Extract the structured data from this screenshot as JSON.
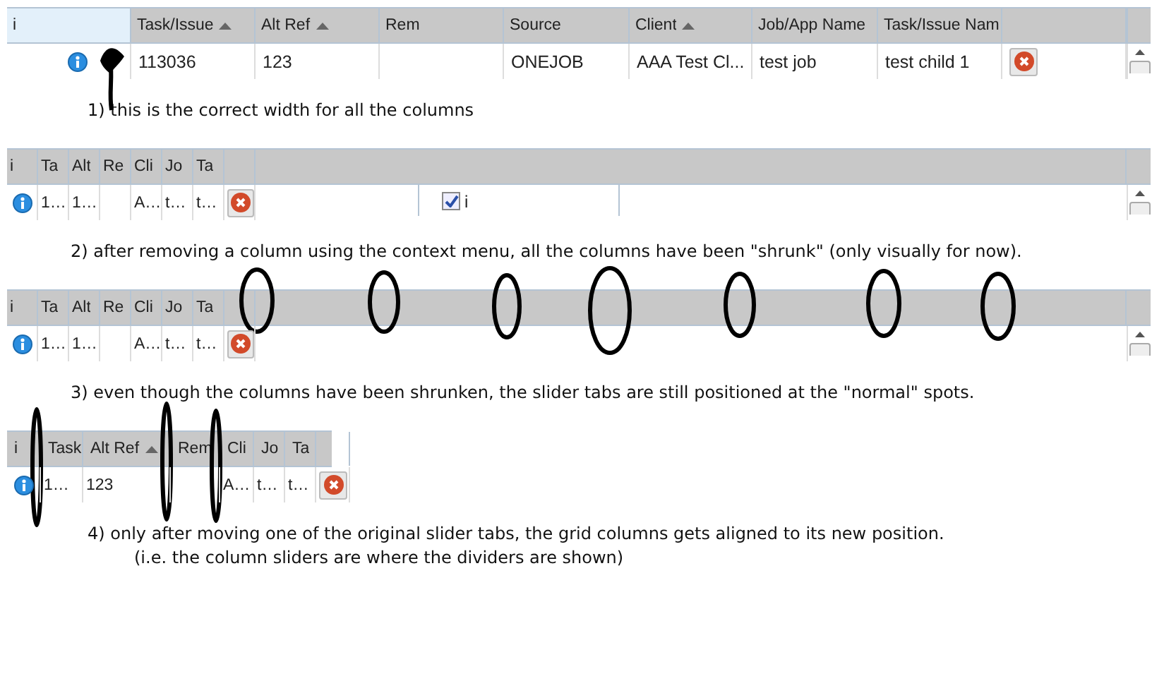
{
  "panels": [
    {
      "kind": "wide",
      "columns": [
        {
          "kind": "info",
          "label": "i",
          "sorted": false,
          "highlighted": true
        },
        {
          "kind": "text",
          "label": "Task/Issue",
          "sorted": true,
          "highlighted": false,
          "value": "113036"
        },
        {
          "kind": "text",
          "label": "Alt Ref",
          "sorted": true,
          "highlighted": false,
          "value": "123"
        },
        {
          "kind": "text",
          "label": "Rem",
          "sorted": false,
          "highlighted": false
        },
        {
          "kind": "text",
          "label": "Source",
          "sorted": false,
          "highlighted": false,
          "value": "ONEJOB"
        },
        {
          "kind": "text",
          "label": "Client",
          "sorted": true,
          "highlighted": false,
          "value": "AAA Test Cl..."
        },
        {
          "kind": "text",
          "label": "Job/App Name",
          "sorted": false,
          "highlighted": false,
          "value": "test job"
        },
        {
          "kind": "text",
          "label": "Task/Issue Nam",
          "sorted": false,
          "highlighted": false,
          "value": "test child 1"
        },
        {
          "kind": "action",
          "sorted": false,
          "highlighted": false
        }
      ],
      "caption": [
        "1) this is the correct width for all the columns"
      ]
    },
    {
      "kind": "shrunk",
      "columns": [
        {
          "kind": "info",
          "label": "i",
          "sorted": false,
          "highlighted": false
        },
        {
          "kind": "text",
          "label": "Ta",
          "sorted": false,
          "highlighted": false,
          "value": "1…"
        },
        {
          "kind": "text",
          "label": "Alt",
          "sorted": false,
          "highlighted": false,
          "value": "1…"
        },
        {
          "kind": "text",
          "label": "Re",
          "sorted": false,
          "highlighted": false
        },
        {
          "kind": "text",
          "label": "Cli",
          "sorted": false,
          "highlighted": false,
          "value": "A…"
        },
        {
          "kind": "text",
          "label": "Jo",
          "sorted": false,
          "highlighted": false,
          "value": "t…"
        },
        {
          "kind": "text",
          "label": "Ta",
          "sorted": false,
          "highlighted": false,
          "value": "t…"
        },
        {
          "kind": "action",
          "sorted": false,
          "highlighted": false
        }
      ],
      "context_menu": [
        {
          "label": "i",
          "checked": true
        }
      ],
      "caption": [
        "2) after removing a column using the context menu, all the columns have been \"shrunk\" (only visually for now)."
      ]
    },
    {
      "kind": "shrunk",
      "columns": [
        {
          "kind": "info",
          "label": "i",
          "sorted": false,
          "highlighted": false
        },
        {
          "kind": "text",
          "label": "Ta",
          "sorted": false,
          "highlighted": false,
          "value": "1…"
        },
        {
          "kind": "text",
          "label": "Alt",
          "sorted": false,
          "highlighted": false,
          "value": "1…"
        },
        {
          "kind": "text",
          "label": "Re",
          "sorted": false,
          "highlighted": false
        },
        {
          "kind": "text",
          "label": "Cli",
          "sorted": false,
          "highlighted": false,
          "value": "A…"
        },
        {
          "kind": "text",
          "label": "Jo",
          "sorted": false,
          "highlighted": false,
          "value": "t…"
        },
        {
          "kind": "text",
          "label": "Ta",
          "sorted": false,
          "highlighted": false,
          "value": "t…"
        },
        {
          "kind": "action",
          "sorted": false,
          "highlighted": false
        }
      ],
      "caption": [
        "3) even though the columns have been shrunken, the slider tabs are still positioned at the \"normal\" spots."
      ]
    },
    {
      "kind": "realigned",
      "columns": [
        {
          "kind": "info",
          "label": "i",
          "sorted": false,
          "highlighted": false
        },
        {
          "kind": "text",
          "label": "Task",
          "sorted": false,
          "highlighted": false,
          "value": "1…"
        },
        {
          "kind": "text",
          "label": "Alt Ref",
          "sorted": true,
          "highlighted": false,
          "value": "123"
        },
        {
          "kind": "text",
          "label": "Rem",
          "sorted": false,
          "highlighted": false
        },
        {
          "kind": "text",
          "label": "Cli",
          "sorted": false,
          "highlighted": false,
          "value": "A…"
        },
        {
          "kind": "text",
          "label": "Jo",
          "sorted": false,
          "highlighted": false,
          "value": "t…"
        },
        {
          "kind": "text",
          "label": "Ta",
          "sorted": false,
          "highlighted": false,
          "value": "t…"
        },
        {
          "kind": "action",
          "sorted": false,
          "highlighted": false
        }
      ],
      "caption": [
        "4) only after moving one of the original slider tabs, the grid columns gets aligned to its new position.",
        "(i.e. the column sliders are where the dividers are shown)"
      ]
    }
  ]
}
